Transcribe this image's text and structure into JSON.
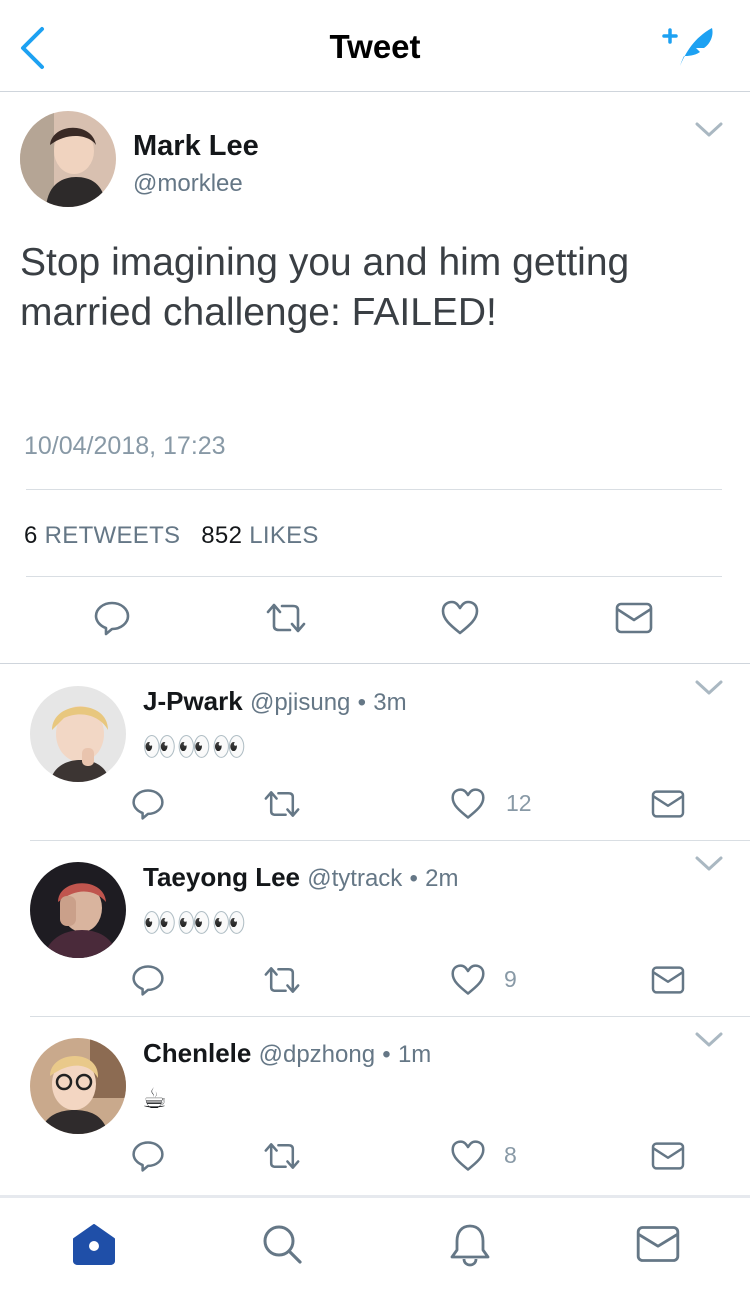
{
  "header": {
    "title": "Tweet"
  },
  "main_tweet": {
    "name": "Mark Lee",
    "handle": "@morklee",
    "text": "Stop imagining you and him getting married challenge: FAILED!",
    "timestamp": "10/04/2018, 17:23",
    "retweets_count": "6",
    "retweets_label": "RETWEETS",
    "likes_count": "852",
    "likes_label": "LIKES"
  },
  "replies": [
    {
      "name": "J-Pwark",
      "handle": "@pjisung",
      "time": "3m",
      "body": "👀👀👀",
      "likes": "12"
    },
    {
      "name": "Taeyong Lee",
      "handle": "@tytrack",
      "time": "2m",
      "body": "👀👀👀",
      "likes": "9"
    },
    {
      "name": "Chenlele",
      "handle": "@dpzhong",
      "time": "1m",
      "body": "☕",
      "likes": "8"
    }
  ],
  "separator": "•",
  "colors": {
    "accent": "#1da1f2",
    "tab_active": "#1f4fa8",
    "icon": "#657786",
    "muted": "#8899a6"
  },
  "icons": [
    "chevron-left-icon",
    "compose-icon",
    "reply-icon",
    "retweet-icon",
    "like-icon",
    "message-icon",
    "home-icon",
    "search-icon",
    "notifications-icon",
    "messages-icon"
  ]
}
